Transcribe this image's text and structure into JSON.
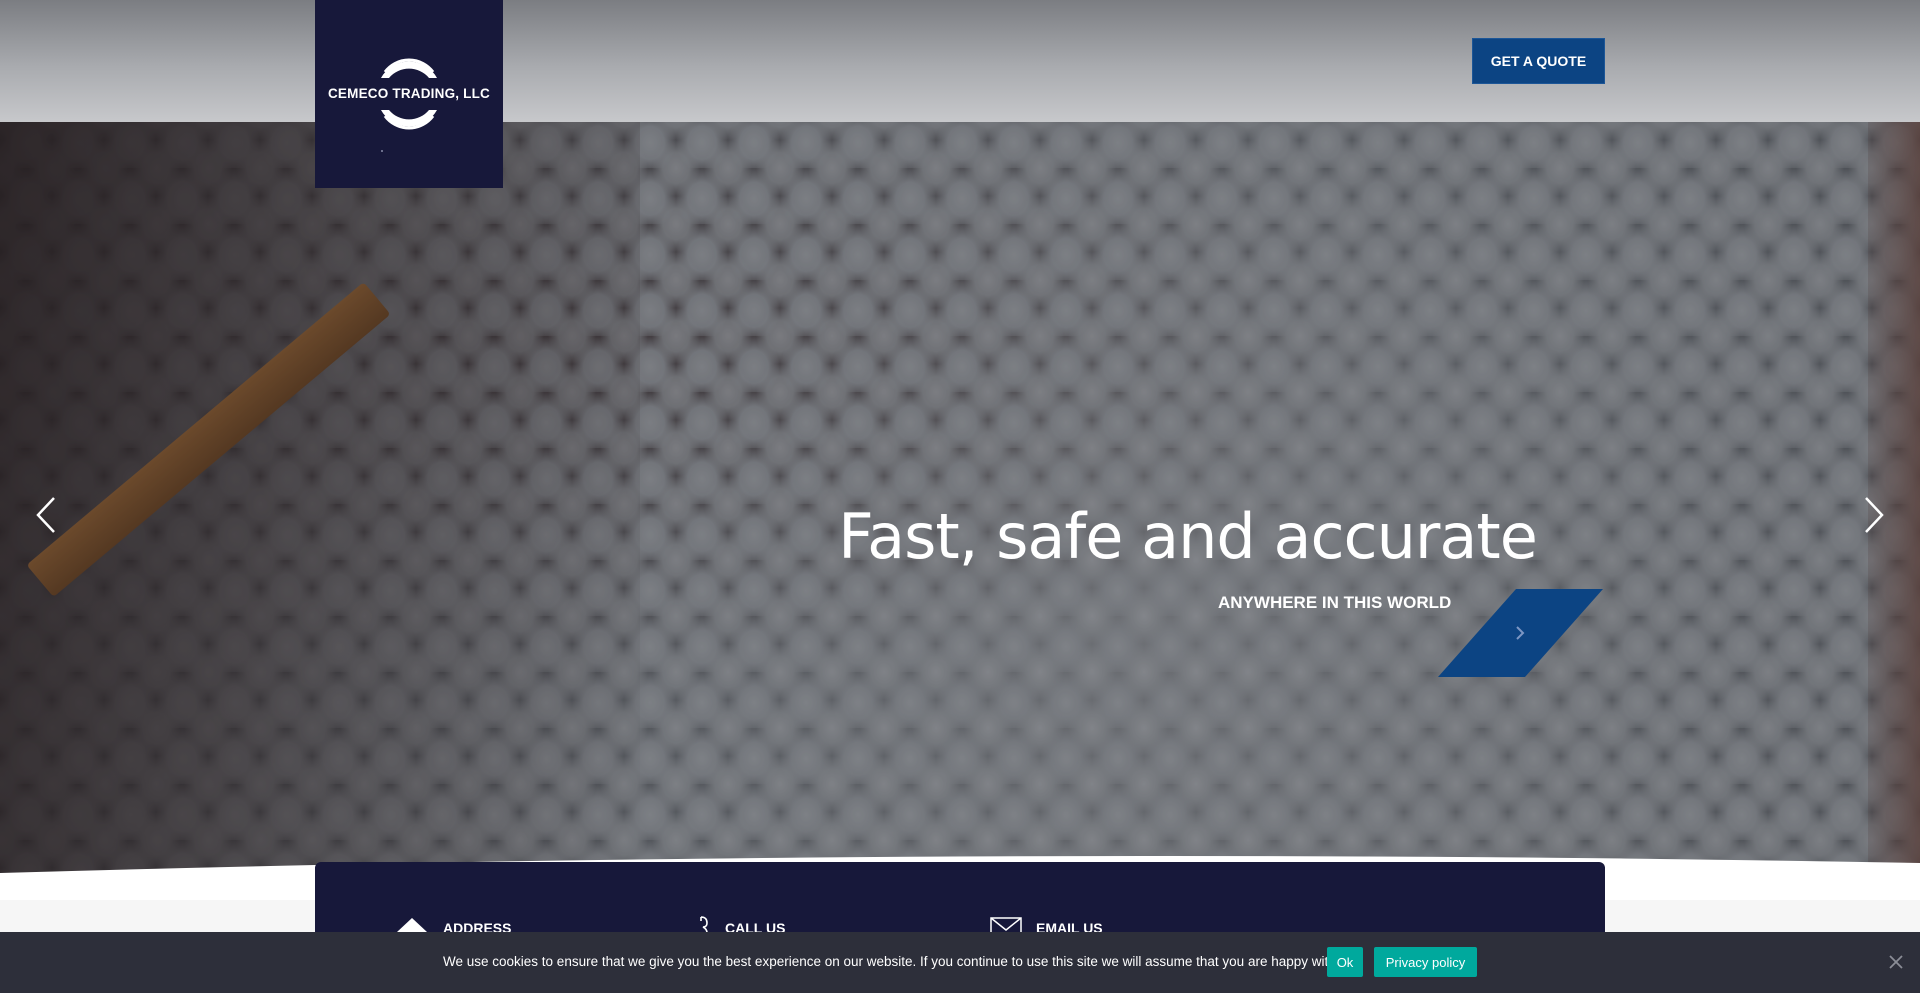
{
  "header": {
    "logo_text": "CEMECO TRADING, LLC",
    "cta_label": "GET A QUOTE"
  },
  "slider": {
    "title": "Fast, safe and accurate",
    "subtitle": "ANYWHERE IN THIS WORLD"
  },
  "contact": {
    "items": [
      {
        "label": "ADDRESS",
        "icon": "home-icon"
      },
      {
        "label": "CALL US",
        "icon": "phone-icon"
      },
      {
        "label": "EMAIL US",
        "icon": "envelope-icon"
      }
    ]
  },
  "cookie": {
    "message": "We use cookies to ensure that we give you the best experience on our website. If you continue to use this site we will assume that you are happy with it.",
    "ok_label": "Ok",
    "privacy_label": "Privacy policy"
  },
  "colors": {
    "navy": "#17183a",
    "brand_blue": "#0c4483",
    "teal": "#00a99d",
    "cookie_bg": "#2d2f3a"
  }
}
